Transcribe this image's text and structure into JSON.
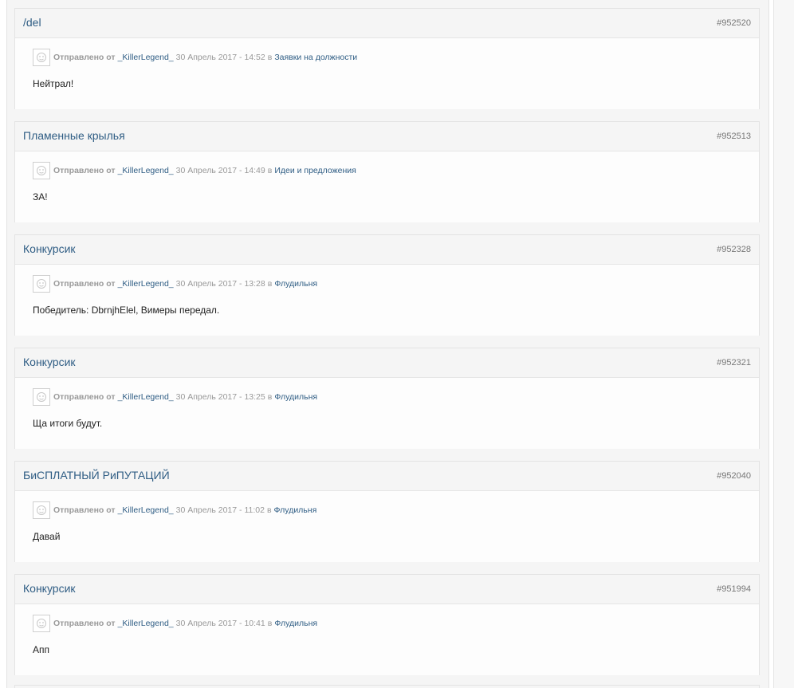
{
  "posts": [
    {
      "title": "/del",
      "id": "#952520",
      "meta_label": "Отправлено от",
      "author": "_KillerLegend_",
      "date": "30 Апрель 2017 - 14:52",
      "in_label": "в",
      "forum": "Заявки на должности",
      "text": "Нейтрал!"
    },
    {
      "title": "Пламенные крылья",
      "id": "#952513",
      "meta_label": "Отправлено от",
      "author": "_KillerLegend_",
      "date": "30 Апрель 2017 - 14:49",
      "in_label": "в",
      "forum": "Идеи и предложения",
      "text": "ЗА!"
    },
    {
      "title": "Конкурсик",
      "id": "#952328",
      "meta_label": "Отправлено от",
      "author": "_KillerLegend_",
      "date": "30 Апрель 2017 - 13:28",
      "in_label": "в",
      "forum": "Флудильня",
      "text": "Победитель: DbrnjhElel, Вимеры передал."
    },
    {
      "title": "Конкурсик",
      "id": "#952321",
      "meta_label": "Отправлено от",
      "author": "_KillerLegend_",
      "date": "30 Апрель 2017 - 13:25",
      "in_label": "в",
      "forum": "Флудильня",
      "text": "Ща итоги будут."
    },
    {
      "title": "БиСПЛАТНЫЙ РиПУТАЦИЙ",
      "id": "#952040",
      "meta_label": "Отправлено от",
      "author": "_KillerLegend_",
      "date": "30 Апрель 2017 - 11:02",
      "in_label": "в",
      "forum": "Флудильня",
      "text": "Давай"
    },
    {
      "title": "Конкурсик",
      "id": "#951994",
      "meta_label": "Отправлено от",
      "author": "_KillerLegend_",
      "date": "30 Апрель 2017 - 10:41",
      "in_label": "в",
      "forum": "Флудильня",
      "text": "Апп"
    }
  ],
  "icons": {
    "avatar": "avatar-placeholder-icon"
  },
  "colors": {
    "link": "#2f5d84",
    "meta": "#999999",
    "text": "#222222",
    "header_bg": "#f5f5f5"
  }
}
